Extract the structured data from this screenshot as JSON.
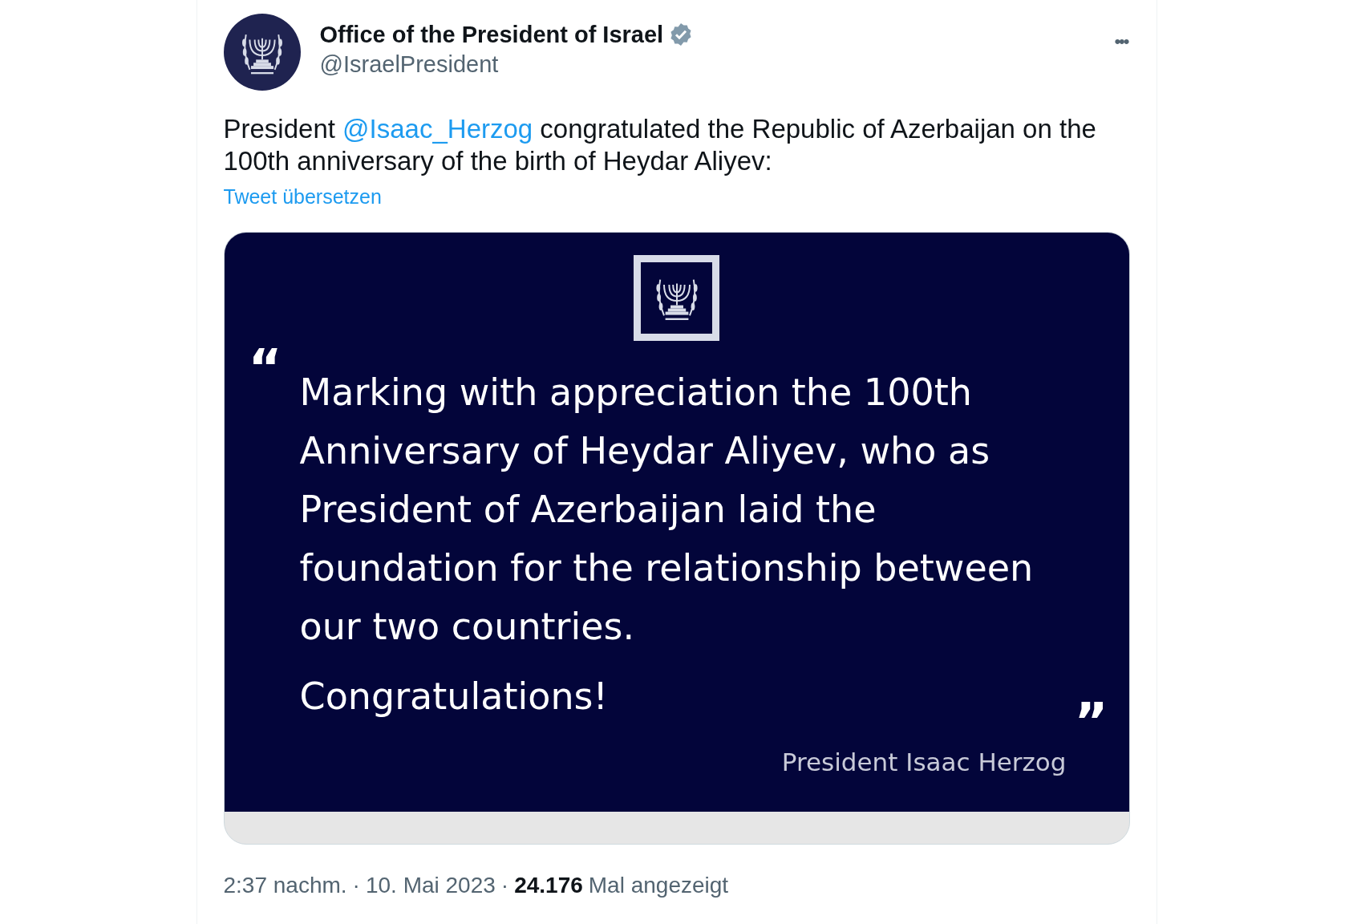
{
  "author": {
    "name": "Office of the President of Israel",
    "verified": true,
    "handle": "@IsraelPresident"
  },
  "more_menu": "•••",
  "tweet": {
    "text_before": "President ",
    "mention": "@Isaac_Herzog",
    "text_after": " congratulated the Republic of Azerbaijan on the 100th anniversary of the birth of Heydar Aliyev:",
    "translate_link": "Tweet übersetzen"
  },
  "card": {
    "open_quote": "“",
    "lines": [
      "Marking with appreciation the 100th",
      "Anniversary of Heydar Aliyev, who as",
      "President of Azerbaijan laid the",
      "foundation for the relationship between",
      "our two countries."
    ],
    "closing": "Congratulations!",
    "close_quote": "”",
    "signature": "President Isaac Herzog"
  },
  "meta": {
    "time": "2:37 nachm.",
    "separator_1": "·",
    "date": "10. Mai 2023",
    "separator_2": "·",
    "views": "24.176",
    "views_label": "Mal angezeigt"
  }
}
